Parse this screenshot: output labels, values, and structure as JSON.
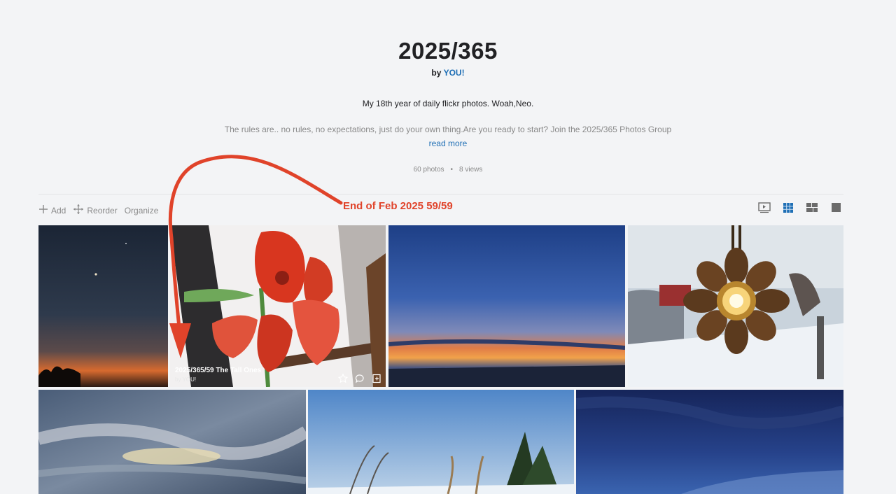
{
  "album": {
    "title": "2025/365",
    "by_prefix": "by",
    "owner": "YOU!",
    "description": "My 18th year of daily flickr photos. Woah,Neo.",
    "description_more": "The rules are.. no rules, no expectations, just do your own thing.Are you ready to start? Join the 2025/365 Photos Group",
    "read_more": "read more",
    "photo_count": "60 photos",
    "separator": "•",
    "views": "8 views"
  },
  "toolbar": {
    "add": "Add",
    "reorder": "Reorder",
    "organize": "Organize"
  },
  "annotation": {
    "text": "End of Feb 2025 59/59",
    "color": "#e0432a"
  },
  "view_modes": [
    "slideshow-icon",
    "grid-icon",
    "mosaic-icon",
    "single-icon"
  ],
  "photos": [
    {
      "title": "",
      "by": ""
    },
    {
      "title": "2025/365/59 The Tall Ones",
      "by": "by YOU!"
    },
    {
      "title": "",
      "by": ""
    },
    {
      "title": "",
      "by": ""
    },
    {
      "title": "",
      "by": ""
    },
    {
      "title": "",
      "by": ""
    },
    {
      "title": "",
      "by": ""
    }
  ],
  "colors": {
    "background": "#f3f4f6",
    "link": "#1f6fb5",
    "muted": "#898989",
    "active_view": "#1f6fb5"
  }
}
